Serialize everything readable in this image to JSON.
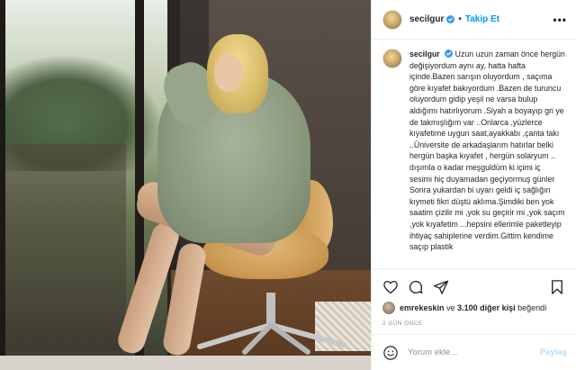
{
  "header": {
    "username": "secilgur",
    "separator": "•",
    "follow_label": "Takip Et",
    "more_icon": "more-horizontal-icon",
    "verified_icon": "verified-badge-icon"
  },
  "caption": {
    "username": "secilgur",
    "text": "Uzun uzun zaman önce hergün değişiyordum aynı ay, hatta hafta içinde.Bazen sarışın oluyordum , saçıma göre kıyafet bakıyordum .Bazen de turuncu oluyordum gidip yeşil ne varsa bulup aldığımı hatırlıyorum .Siyah a boyayıp gri ye de takmışlığım var ..Onlarca ,yüzlerce kıyafetime uygun saat,ayakkabı ,çanta takı ..Üniversite de arkadaşlarım hatırlar belki hergün başka kıyafet , hergün solaryum .. dışımla o kadar meşguldüm ki içimi iç sesimi hiç duyamadan geçiyormuş günler Sonra yukardan bi uyarı geldi iç sağlığın kıymeti fikri düştü aklıma.Şimdiki ben yok saatim çizilir mi ,yok su geçirir mi ,yok saçım ,yok kıyafetim ...hepsini ellerimle paketleyip ihtiyaç sahiplerine verdim.Gittim kendime saçıp plastik"
  },
  "actions": {
    "like_icon": "heart-icon",
    "comment_icon": "comment-icon",
    "share_icon": "share-icon",
    "save_icon": "bookmark-icon"
  },
  "likes": {
    "first_liker": "emrekeskin",
    "connector": "ve",
    "others": "3.100 diğer kişi",
    "suffix": "beğendi"
  },
  "timestamp": "2 GÜN ÖNCE",
  "add_comment": {
    "emoji_icon": "emoji-icon",
    "placeholder": "Yorum ekle...",
    "post_label": "Paylaş"
  },
  "colors": {
    "accent": "#0095f6",
    "post_disabled": "#b2dffc",
    "muted": "#8e8e8e",
    "border": "#efefef"
  }
}
